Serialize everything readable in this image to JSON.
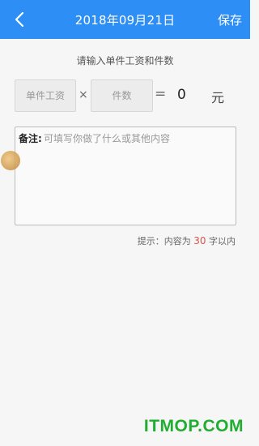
{
  "header": {
    "back_icon": "chevron-left-icon",
    "title": "2018年09月21日",
    "save_label": "保存"
  },
  "form": {
    "prompt": "请输入单件工资和件数",
    "unit_wage_placeholder": "单件工资",
    "quantity_placeholder": "件数",
    "times_symbol": "×",
    "equals_symbol": "=",
    "result_value": "0",
    "result_unit": "元"
  },
  "note": {
    "label": "备注:",
    "placeholder": "可填写你做了什么或其他内容"
  },
  "hint": {
    "prefix": "提示：内容为 ",
    "limit": "30",
    "suffix": " 字以内"
  },
  "watermark": "ITMOP.COM",
  "colors": {
    "header_bg": "#2d8ef5",
    "limit_number": "#d9534f",
    "watermark": "#1fae2f"
  }
}
